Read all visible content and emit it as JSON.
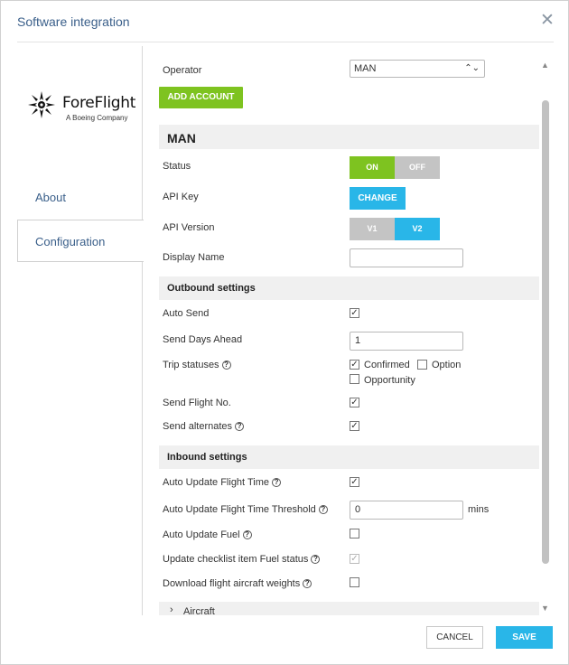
{
  "dialog": {
    "title": "Software integration",
    "close_icon": "close-icon"
  },
  "sidebar": {
    "logo_text": "ForeFlight",
    "logo_sub": "A Boeing Company",
    "items": [
      {
        "label": "About"
      },
      {
        "label": "Configuration",
        "active": true
      }
    ]
  },
  "form": {
    "operator_label": "Operator",
    "operator_value": "MAN",
    "add_account": "ADD ACCOUNT",
    "account_section": "MAN",
    "status_label": "Status",
    "status_on": "ON",
    "status_off": "OFF",
    "status_value": "ON",
    "api_key_label": "API Key",
    "api_key_button": "CHANGE",
    "api_version_label": "API Version",
    "api_v1": "V1",
    "api_v2": "V2",
    "api_version_value": "V2",
    "display_name_label": "Display Name",
    "display_name_value": "",
    "outbound_section": "Outbound settings",
    "auto_send_label": "Auto Send",
    "auto_send": true,
    "send_days_label": "Send Days Ahead",
    "send_days_value": "1",
    "trip_statuses_label": "Trip statuses",
    "trip_statuses": [
      {
        "label": "Confirmed",
        "checked": true
      },
      {
        "label": "Option",
        "checked": false
      },
      {
        "label": "Opportunity",
        "checked": false
      }
    ],
    "send_flight_no_label": "Send Flight No.",
    "send_flight_no": true,
    "send_alternates_label": "Send alternates",
    "send_alternates": true,
    "inbound_section": "Inbound settings",
    "auto_update_time_label": "Auto Update Flight Time",
    "auto_update_time": true,
    "threshold_label": "Auto Update Flight Time Threshold",
    "threshold_value": "0",
    "threshold_unit": "mins",
    "auto_update_fuel_label": "Auto Update Fuel",
    "auto_update_fuel": false,
    "checklist_fuel_label": "Update checklist item Fuel status",
    "checklist_fuel": true,
    "checklist_fuel_disabled": true,
    "download_weights_label": "Download flight aircraft weights",
    "download_weights": false,
    "aircraft_section": "Aircraft"
  },
  "footer": {
    "cancel": "CANCEL",
    "save": "SAVE"
  },
  "colors": {
    "accent_blue": "#29b6e8",
    "accent_green": "#7ec320",
    "title_blue": "#3a5f8a"
  }
}
